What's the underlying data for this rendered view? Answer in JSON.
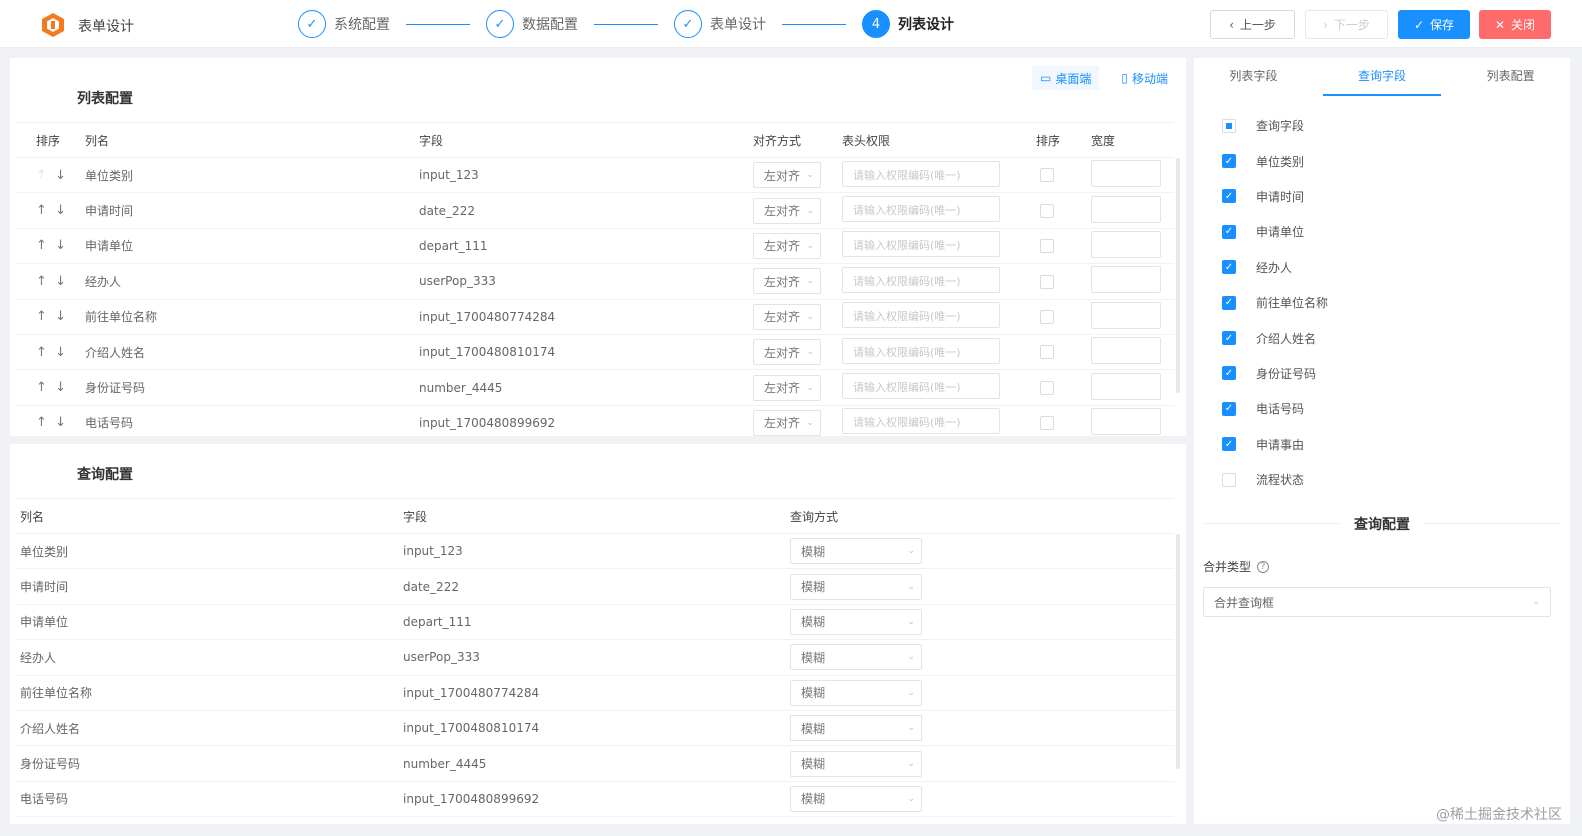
{
  "header": {
    "app_title": "表单设计",
    "steps": [
      {
        "label": "系统配置",
        "state": "done"
      },
      {
        "label": "数据配置",
        "state": "done"
      },
      {
        "label": "表单设计",
        "state": "done"
      },
      {
        "label": "列表设计",
        "state": "active",
        "number": "4"
      }
    ],
    "buttons": {
      "prev": "上一步",
      "next": "下一步",
      "save": "保存",
      "close": "关闭"
    }
  },
  "list_config": {
    "title": "列表配置",
    "device_tabs": [
      {
        "label": "桌面端",
        "active": true
      },
      {
        "label": "移动端",
        "active": false
      }
    ],
    "columns": {
      "sort": "排序",
      "name": "列名",
      "field": "字段",
      "align": "对齐方式",
      "perm": "表头权限",
      "order": "排序",
      "width": "宽度"
    },
    "rows": [
      {
        "name": "单位类别",
        "field": "input_123",
        "align": "左对齐",
        "perm_placeholder": "请输入权限编码(唯一)"
      },
      {
        "name": "申请时间",
        "field": "date_222",
        "align": "左对齐",
        "perm_placeholder": "请输入权限编码(唯一)"
      },
      {
        "name": "申请单位",
        "field": "depart_111",
        "align": "左对齐",
        "perm_placeholder": "请输入权限编码(唯一)"
      },
      {
        "name": "经办人",
        "field": "userPop_333",
        "align": "左对齐",
        "perm_placeholder": "请输入权限编码(唯一)"
      },
      {
        "name": "前往单位名称",
        "field": "input_1700480774284",
        "align": "左对齐",
        "perm_placeholder": "请输入权限编码(唯一)"
      },
      {
        "name": "介绍人姓名",
        "field": "input_1700480810174",
        "align": "左对齐",
        "perm_placeholder": "请输入权限编码(唯一)"
      },
      {
        "name": "身份证号码",
        "field": "number_4445",
        "align": "左对齐",
        "perm_placeholder": "请输入权限编码(唯一)"
      },
      {
        "name": "电话号码",
        "field": "input_1700480899692",
        "align": "左对齐",
        "perm_placeholder": "请输入权限编码(唯一)"
      }
    ]
  },
  "query_config": {
    "title": "查询配置",
    "columns": {
      "name": "列名",
      "field": "字段",
      "mode": "查询方式"
    },
    "rows": [
      {
        "name": "单位类别",
        "field": "input_123",
        "mode": "模糊"
      },
      {
        "name": "申请时间",
        "field": "date_222",
        "mode": "模糊"
      },
      {
        "name": "申请单位",
        "field": "depart_111",
        "mode": "模糊"
      },
      {
        "name": "经办人",
        "field": "userPop_333",
        "mode": "模糊"
      },
      {
        "name": "前往单位名称",
        "field": "input_1700480774284",
        "mode": "模糊"
      },
      {
        "name": "介绍人姓名",
        "field": "input_1700480810174",
        "mode": "模糊"
      },
      {
        "name": "身份证号码",
        "field": "number_4445",
        "mode": "模糊"
      },
      {
        "name": "电话号码",
        "field": "input_1700480899692",
        "mode": "模糊"
      }
    ]
  },
  "side": {
    "tabs": [
      {
        "label": "列表字段",
        "active": false
      },
      {
        "label": "查询字段",
        "active": true
      },
      {
        "label": "列表配置",
        "active": false
      }
    ],
    "items": [
      {
        "label": "查询字段",
        "state": "partial"
      },
      {
        "label": "单位类别",
        "state": "checked"
      },
      {
        "label": "申请时间",
        "state": "checked"
      },
      {
        "label": "申请单位",
        "state": "checked"
      },
      {
        "label": "经办人",
        "state": "checked"
      },
      {
        "label": "前往单位名称",
        "state": "checked"
      },
      {
        "label": "介绍人姓名",
        "state": "checked"
      },
      {
        "label": "身份证号码",
        "state": "checked"
      },
      {
        "label": "电话号码",
        "state": "checked"
      },
      {
        "label": "申请事由",
        "state": "checked"
      },
      {
        "label": "流程状态",
        "state": "unchecked"
      }
    ],
    "query_title": "查询配置",
    "merge_label": "合并类型",
    "merge_value": "合并查询框"
  },
  "watermark": "@稀土掘金技术社区",
  "colors": {
    "primary": "#1890ff",
    "danger": "#ff6b6b"
  }
}
